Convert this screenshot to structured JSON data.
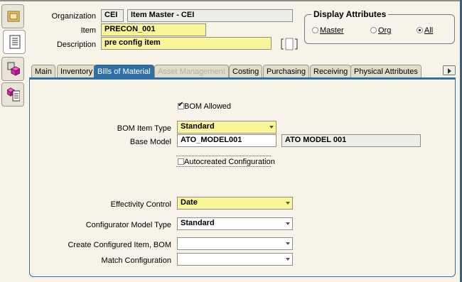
{
  "header": {
    "organization_label": "Organization",
    "organization_value": "CEI",
    "organization_name": "Item Master - CEI",
    "item_label": "Item",
    "item_value": "PRECON_001",
    "description_label": "Description",
    "description_value": "pre config item"
  },
  "display_attributes": {
    "title": "Display Attributes",
    "options": [
      "Master",
      "Org",
      "All"
    ],
    "selected": "All"
  },
  "tabs": [
    {
      "label": "Main",
      "state": "normal"
    },
    {
      "label": "Inventory",
      "state": "normal"
    },
    {
      "label": "Bills of Material",
      "state": "active"
    },
    {
      "label": "Asset Management",
      "state": "disabled"
    },
    {
      "label": "Costing",
      "state": "normal"
    },
    {
      "label": "Purchasing",
      "state": "normal"
    },
    {
      "label": "Receiving",
      "state": "normal"
    },
    {
      "label": "Physical Attributes",
      "state": "normal"
    }
  ],
  "bom": {
    "bom_allowed_label": "BOM Allowed",
    "bom_allowed_checked": true,
    "item_type_label": "BOM Item Type",
    "item_type_value": "Standard",
    "base_model_label": "Base Model",
    "base_model_value": "ATO_MODEL001",
    "base_model_desc": "ATO MODEL 001",
    "autocreated_label": "Autocreated Configuration",
    "autocreated_checked": false,
    "effectivity_label": "Effectivity Control",
    "effectivity_value": "Date",
    "configurator_label": "Configurator Model Type",
    "configurator_value": "Standard",
    "create_configured_label": "Create Configured Item, BOM",
    "create_configured_value": "",
    "match_config_label": "Match Configuration",
    "match_config_value": ""
  },
  "colors": {
    "background": "#f7f3e8",
    "required_field": "#fbf59a",
    "active_tab": "#2f6fa3"
  },
  "icons": [
    "org-folder-icon",
    "item-list-icon",
    "item-cube-icon",
    "catalog-icon",
    "scroll-right-icon",
    "checkmark-icon"
  ]
}
